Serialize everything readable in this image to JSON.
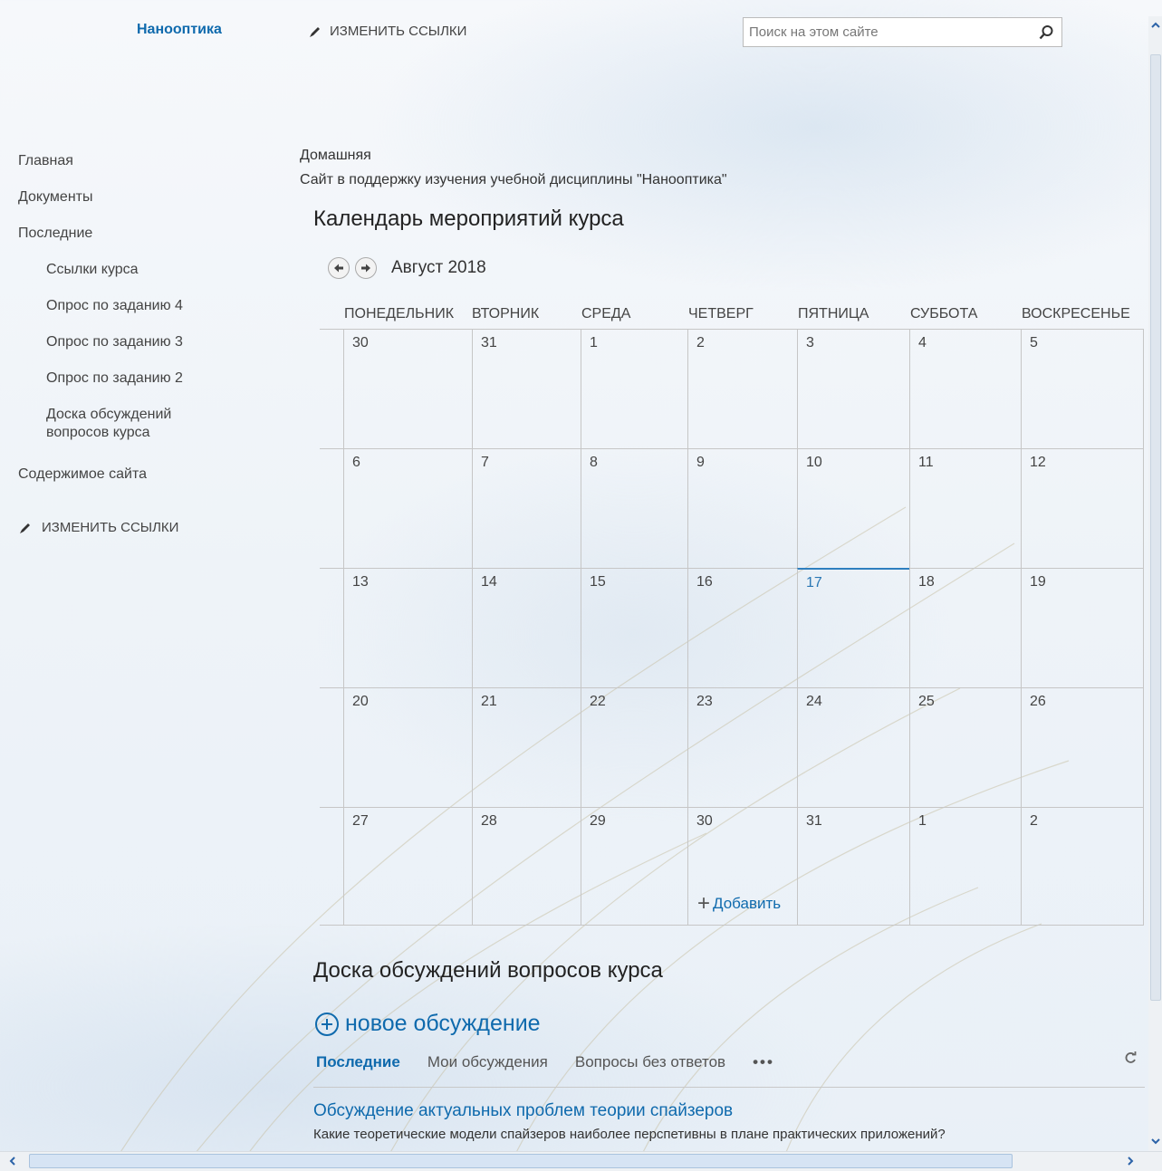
{
  "header": {
    "site_title": "Нанооптика",
    "edit_links": "ИЗМЕНИТЬ ССЫЛКИ",
    "search_placeholder": "Поиск на этом сайте"
  },
  "leftnav": {
    "items": [
      {
        "label": "Главная"
      },
      {
        "label": "Документы"
      },
      {
        "label": "Последние"
      },
      {
        "label": "Ссылки курса"
      },
      {
        "label": "Опрос по заданию 4"
      },
      {
        "label": "Опрос по заданию 3"
      },
      {
        "label": "Опрос по заданию 2"
      },
      {
        "label": "Доска обсуждений вопросов курса"
      },
      {
        "label": "Содержимое сайта"
      }
    ],
    "edit_links": "ИЗМЕНИТЬ ССЫЛКИ"
  },
  "page": {
    "breadcrumb": "Домашняя",
    "description": "Сайт в поддержку изучения учебной дисциплины \"Нанооптика\""
  },
  "calendar": {
    "title": "Календарь мероприятий курса",
    "month": "Август 2018",
    "weekdays": [
      "ПОНЕДЕЛЬНИК",
      "ВТОРНИК",
      "СРЕДА",
      "ЧЕТВЕРГ",
      "ПЯТНИЦА",
      "СУББОТА",
      "ВОСКРЕСЕНЬЕ"
    ],
    "weeks": [
      [
        "30",
        "31",
        "1",
        "2",
        "3",
        "4",
        "5"
      ],
      [
        "6",
        "7",
        "8",
        "9",
        "10",
        "11",
        "12"
      ],
      [
        "13",
        "14",
        "15",
        "16",
        "17",
        "18",
        "19"
      ],
      [
        "20",
        "21",
        "22",
        "23",
        "24",
        "25",
        "26"
      ],
      [
        "27",
        "28",
        "29",
        "30",
        "31",
        "1",
        "2"
      ]
    ],
    "today": "17",
    "add_label": "Добавить",
    "colors": {
      "accent": "#0f6aad",
      "today_line": "#2f7fbf"
    }
  },
  "board": {
    "title": "Доска обсуждений вопросов курса",
    "new_discussion": "новое обсуждение",
    "tabs": [
      "Последние",
      "Мои обсуждения",
      "Вопросы без ответов"
    ],
    "more": "•••",
    "topic": {
      "title": "Обсуждение актуальных проблем теории спайзеров",
      "description": "Какие теоретические модели спайзеров наиболее перспетивны в плане практических приложений?"
    }
  }
}
